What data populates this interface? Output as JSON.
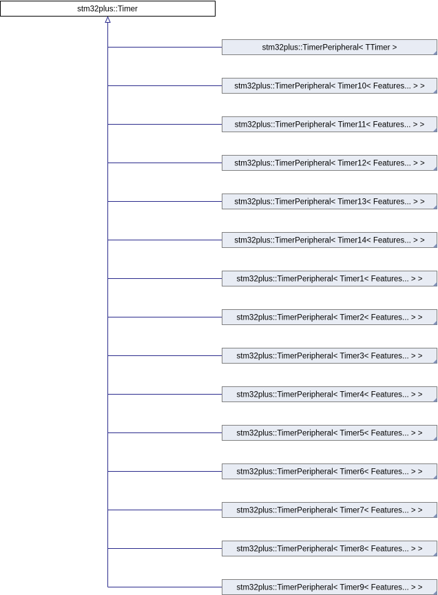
{
  "diagram": {
    "root": {
      "label": "stm32plus::Timer"
    },
    "children": [
      {
        "label": "stm32plus::TimerPeripheral< TTimer >"
      },
      {
        "label": "stm32plus::TimerPeripheral< Timer10< Features... > >"
      },
      {
        "label": "stm32plus::TimerPeripheral< Timer11< Features... > >"
      },
      {
        "label": "stm32plus::TimerPeripheral< Timer12< Features... > >"
      },
      {
        "label": "stm32plus::TimerPeripheral< Timer13< Features... > >"
      },
      {
        "label": "stm32plus::TimerPeripheral< Timer14< Features... > >"
      },
      {
        "label": "stm32plus::TimerPeripheral< Timer1< Features... > >"
      },
      {
        "label": "stm32plus::TimerPeripheral< Timer2< Features... > >"
      },
      {
        "label": "stm32plus::TimerPeripheral< Timer3< Features... > >"
      },
      {
        "label": "stm32plus::TimerPeripheral< Timer4< Features... > >"
      },
      {
        "label": "stm32plus::TimerPeripheral< Timer5< Features... > >"
      },
      {
        "label": "stm32plus::TimerPeripheral< Timer6< Features... > >"
      },
      {
        "label": "stm32plus::TimerPeripheral< Timer7< Features... > >"
      },
      {
        "label": "stm32plus::TimerPeripheral< Timer8< Features... > >"
      },
      {
        "label": "stm32plus::TimerPeripheral< Timer9< Features... > >"
      }
    ]
  },
  "colors": {
    "edge": "#2a2a8c",
    "child_fill": "#e8ecf4",
    "child_border": "#808080",
    "root_border": "#000000"
  }
}
